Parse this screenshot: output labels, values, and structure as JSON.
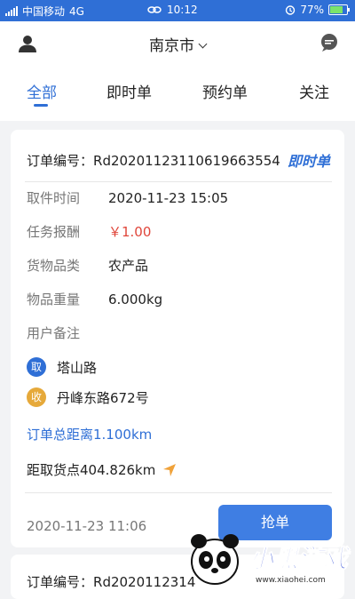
{
  "status_bar": {
    "carrier": "中国移动",
    "network": "4G",
    "time": "10:12",
    "battery": "77%",
    "battery_level": 0.77
  },
  "header": {
    "city": "南京市",
    "icons": [
      "user-icon",
      "message-icon",
      "chevron-down-icon"
    ]
  },
  "tabs": [
    {
      "label": "全部",
      "active": true
    },
    {
      "label": "即时单",
      "active": false
    },
    {
      "label": "预约单",
      "active": false
    },
    {
      "label": "关注",
      "active": false
    }
  ],
  "order": {
    "number_label": "订单编号：",
    "number": "Rd2020112311061966355​4",
    "type": "即时单",
    "fields": [
      {
        "label": "取件时间",
        "value": "2020-11-23 15:05"
      },
      {
        "label": "任务报酬",
        "value": "￥1.00"
      },
      {
        "label": "货物品类",
        "value": "农产品"
      },
      {
        "label": "物品重量",
        "value": "6.000kg"
      },
      {
        "label": "用户备注",
        "value": ""
      }
    ],
    "pickup": {
      "badge": "取",
      "address": "塔山路"
    },
    "dropoff": {
      "badge": "收",
      "address": "丹峰东路672号"
    },
    "total_distance": "订单总距离1.100km",
    "pickup_distance": "距取货点404.826km",
    "created_time": "2020-11-23 11:06",
    "grab_button": "抢单",
    "colors": {
      "accent": "#2f6fd6",
      "price": "#e0463b",
      "pickup_badge": "#2f6fd6",
      "dropoff_badge": "#e6a93a",
      "nav_arrow": "#f0a23a"
    }
  },
  "next_order": {
    "number_label": "订单编号：",
    "number": "Rd2020112314"
  },
  "watermark": {
    "text": "小黑游戏",
    "url": "www.xiaohei.com"
  }
}
